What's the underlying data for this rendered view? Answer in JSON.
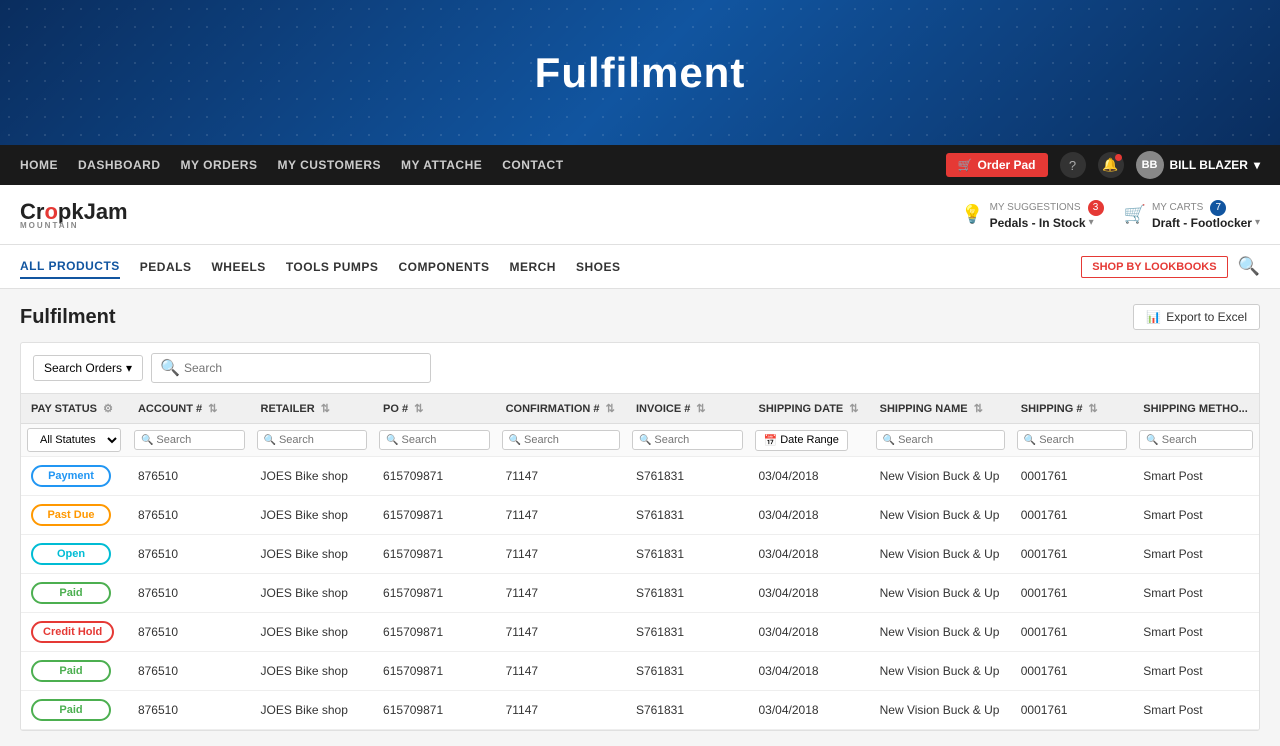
{
  "hero": {
    "title": "Fulfilment",
    "dots_pattern": true
  },
  "topnav": {
    "items": [
      "HOME",
      "DASHBOARD",
      "MY ORDERS",
      "MY CUSTOMERS",
      "MY ATTACHE",
      "CONTACT"
    ],
    "order_pad_label": "Order Pad",
    "user_name": "BILL BLAZER",
    "notification_badge": true
  },
  "brandbar": {
    "logo_text_pre": "Cr",
    "logo_o": "o",
    "logo_text_post": "pkJam",
    "logo_sub": "MOUNTAIN",
    "suggestions_label": "MY SUGGESTIONS",
    "suggestions_badge": "3",
    "suggestions_value": "Pedals - In Stock",
    "carts_label": "MY CARTS",
    "carts_badge": "7",
    "carts_value": "Draft - Footlocker"
  },
  "catnav": {
    "items": [
      "ALL PRODUCTS",
      "PEDALS",
      "WHEELS",
      "TOOLS PUMPS",
      "COMPONENTS",
      "MERCH",
      "SHOES"
    ],
    "lookbooks_label": "SHOP BY LOOKBOOKS"
  },
  "page": {
    "title": "Fulfilment",
    "export_label": "Export to Excel"
  },
  "toolbar": {
    "search_orders_label": "Search Orders",
    "search_placeholder": "Search"
  },
  "table": {
    "columns": [
      "PAY STATUS",
      "ACCOUNT #",
      "RETAILER",
      "PO #",
      "CONFIRMATION #",
      "INVOICE #",
      "SHIPPING DATE",
      "SHIPPING NAME",
      "SHIPPING #",
      "SHIPPING METHO..."
    ],
    "filter_statutes": "All Statutes",
    "filter_search_placeholder": "Search",
    "filter_date_placeholder": "Date Range",
    "rows": [
      {
        "status": "Payment",
        "status_type": "payment",
        "account": "876510",
        "retailer": "JOES Bike shop",
        "po": "615709871",
        "confirmation": "71147",
        "invoice": "S761831",
        "ship_date": "03/04/2018",
        "ship_name": "New Vision Buck & Up",
        "ship_num": "0001761",
        "ship_method": "Smart Post"
      },
      {
        "status": "Past Due",
        "status_type": "past-due",
        "account": "876510",
        "retailer": "JOES Bike shop",
        "po": "615709871",
        "confirmation": "71147",
        "invoice": "S761831",
        "ship_date": "03/04/2018",
        "ship_name": "New Vision Buck & Up",
        "ship_num": "0001761",
        "ship_method": "Smart Post"
      },
      {
        "status": "Open",
        "status_type": "open",
        "account": "876510",
        "retailer": "JOES Bike shop",
        "po": "615709871",
        "confirmation": "71147",
        "invoice": "S761831",
        "ship_date": "03/04/2018",
        "ship_name": "New Vision Buck & Up",
        "ship_num": "0001761",
        "ship_method": "Smart Post"
      },
      {
        "status": "Paid",
        "status_type": "paid",
        "account": "876510",
        "retailer": "JOES Bike shop",
        "po": "615709871",
        "confirmation": "71147",
        "invoice": "S761831",
        "ship_date": "03/04/2018",
        "ship_name": "New Vision Buck & Up",
        "ship_num": "0001761",
        "ship_method": "Smart Post"
      },
      {
        "status": "Credit Hold",
        "status_type": "credit-hold",
        "account": "876510",
        "retailer": "JOES Bike shop",
        "po": "615709871",
        "confirmation": "71147",
        "invoice": "S761831",
        "ship_date": "03/04/2018",
        "ship_name": "New Vision Buck & Up",
        "ship_num": "0001761",
        "ship_method": "Smart Post"
      },
      {
        "status": "Paid",
        "status_type": "paid",
        "account": "876510",
        "retailer": "JOES Bike shop",
        "po": "615709871",
        "confirmation": "71147",
        "invoice": "S761831",
        "ship_date": "03/04/2018",
        "ship_name": "New Vision Buck & Up",
        "ship_num": "0001761",
        "ship_method": "Smart Post"
      },
      {
        "status": "Paid",
        "status_type": "paid",
        "account": "876510",
        "retailer": "JOES Bike shop",
        "po": "615709871",
        "confirmation": "71147",
        "invoice": "S761831",
        "ship_date": "03/04/2018",
        "ship_name": "New Vision Buck & Up",
        "ship_num": "0001761",
        "ship_method": "Smart Post"
      }
    ]
  }
}
